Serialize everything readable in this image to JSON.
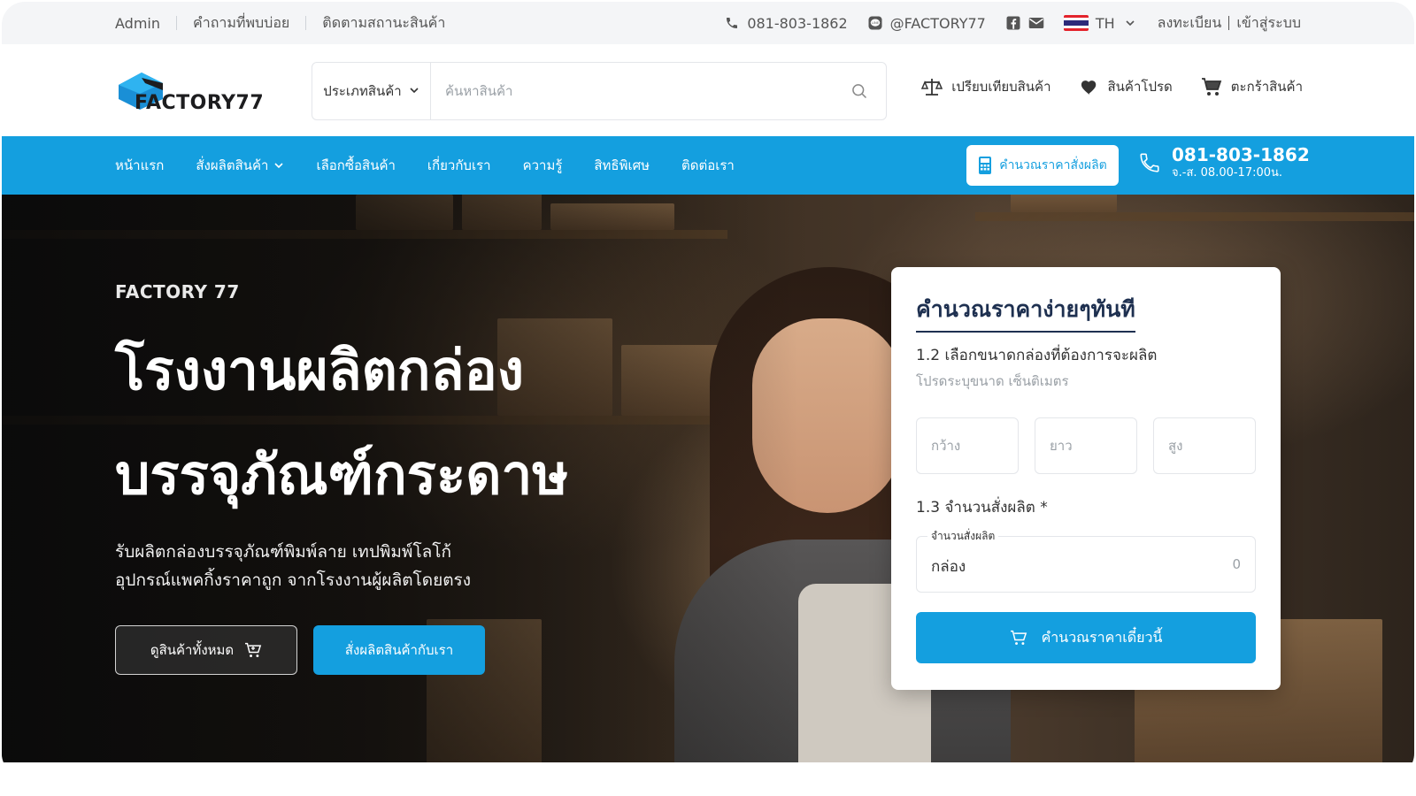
{
  "topbar": {
    "links": [
      "Admin",
      "คำถามที่พบบ่อย",
      "ติดตามสถานะสินค้า"
    ],
    "phone": "081-803-1862",
    "line": "@FACTORY77",
    "language": "TH",
    "register": "ลงทะเบียน",
    "login": "เข้าสู่ระบบ"
  },
  "header": {
    "logo_text": "FACTORY77",
    "search": {
      "category_label": "ประเภทสินค้า",
      "placeholder": "ค้นหาสินค้า"
    },
    "actions": {
      "compare": "เปรียบเทียบสินค้า",
      "wishlist": "สินค้าโปรด",
      "cart": "ตะกร้าสินค้า"
    }
  },
  "nav": {
    "items": [
      "หน้าแรก",
      "สั่งผลิตสินค้า",
      "เลือกซื้อสินค้า",
      "เกี่ยวกับเรา",
      "ความรู้",
      "สิทธิพิเศษ",
      "ติดต่อเรา"
    ],
    "calc_button": "คำนวณราคาสั่งผลิต",
    "phone": "081-803-1862",
    "hours": "จ.-ส. 08.00-17:00น."
  },
  "hero": {
    "kicker": "FACTORY 77",
    "title_line1": "โรงงานผลิตกล่อง",
    "title_line2": "บรรจุภัณฑ์กระดาษ",
    "desc_line1": "รับผลิตกล่องบรรจุภัณฑ์พิมพ์ลาย เทปพิมพ์โลโก้",
    "desc_line2": "อุปกรณ์แพคกิ้งราคาถูก จากโรงงานผู้ผลิตโดยตรง",
    "btn_all_products": "ดูสินค้าทั้งหมด",
    "btn_order": "สั่งผลิตสินค้ากับเรา"
  },
  "calculator": {
    "title": "คำนวณราคาง่ายๆทันที",
    "step1": "1.2 เลือกขนาดกล่องที่ต้องการจะผลิต",
    "step1_hint": "โปรดระบุขนาด เซ็นติเมตร",
    "width_placeholder": "กว้าง",
    "length_placeholder": "ยาว",
    "height_placeholder": "สูง",
    "step2": "1.3 จำนวนสั่งผลิต *",
    "qty_label": "จำนวนสั่งผลิต",
    "qty_unit": "กล่อง",
    "qty_value": "0",
    "submit": "คำนวณราคาเดี๋ยวนี้"
  },
  "colors": {
    "brand_blue": "#149fdf",
    "dark_navy": "#1e3050",
    "topbar_bg": "#f4f5f7"
  }
}
